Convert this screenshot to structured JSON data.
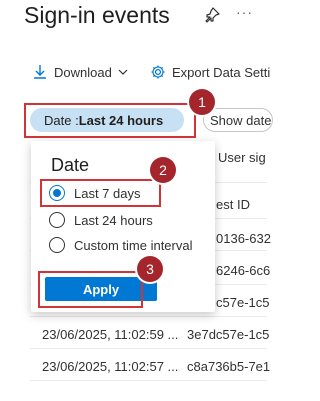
{
  "header": {
    "title": "Sign-in events",
    "pin_icon": "pin-icon",
    "more_label": "···"
  },
  "toolbar": {
    "download_label": "Download",
    "export_label": "Export Data Setti",
    "download_icon": "download-icon",
    "export_icon": "gear-icon"
  },
  "filters": {
    "date_prefix": "Date : ",
    "date_value": "Last 24 hours",
    "show_dates_label": "Show dates"
  },
  "popup": {
    "title": "Date",
    "options": [
      {
        "label": "Last 7 days",
        "selected": true
      },
      {
        "label": "Last 24 hours",
        "selected": false
      },
      {
        "label": "Custom time interval",
        "selected": false
      }
    ],
    "apply_label": "Apply"
  },
  "table": {
    "visible_header_fragments": {
      "user_col": "User sig",
      "request_id_col": "est ID"
    },
    "request_id_fragments": [
      "0136-632",
      "6246-6c6",
      "c57e-1c5",
      "c57e-1c5"
    ],
    "rows": [
      {
        "date": "23/06/2025, 11:02:59 ...",
        "request_id": "3e7dc57e-1c5"
      },
      {
        "date": "23/06/2025, 11:02:57 ...",
        "request_id": "c8a736b5-7e1"
      }
    ]
  },
  "annotations": {
    "callout_1": "1",
    "callout_2": "2",
    "callout_3": "3"
  },
  "colors": {
    "accent": "#0078d4",
    "pill_bg": "#c7e0f4",
    "highlight": "#d13438",
    "badge": "#a4262c"
  }
}
